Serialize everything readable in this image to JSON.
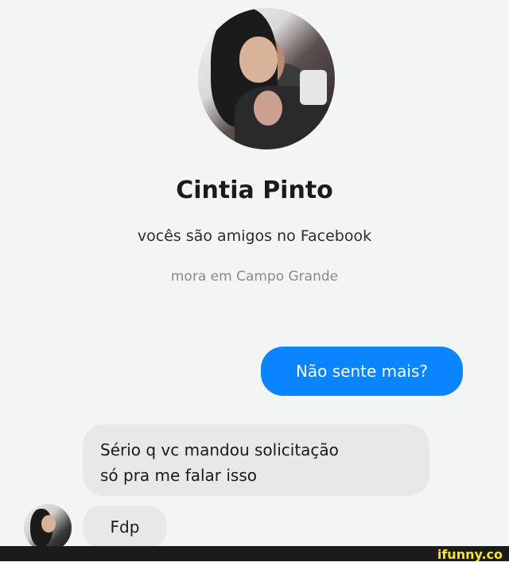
{
  "profile": {
    "name": "Cintia Pinto",
    "friends_line": "vocês são amigos no Facebook",
    "location": "mora em Campo Grande"
  },
  "messages": {
    "outgoing": "Não sente mais?",
    "incoming_1_line_1": "Sério q vc mandou solicitação",
    "incoming_1_line_2": "só pra me falar isso",
    "incoming_2": "Fdp"
  },
  "footer": {
    "brand": "ifunny.co"
  },
  "colors": {
    "outgoing_bubble": "#0a84ff",
    "incoming_bubble": "#e8e8e8",
    "background": "#f3f5f4",
    "brand_yellow": "#f7e23a"
  }
}
